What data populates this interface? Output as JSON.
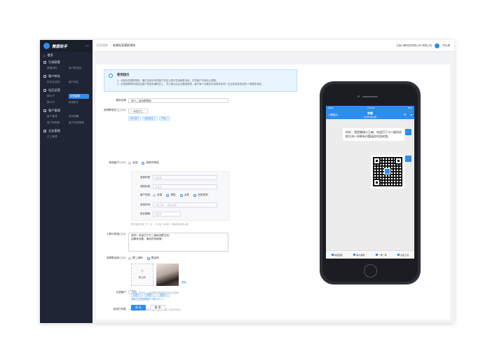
{
  "app": {
    "name": "微盟助手"
  },
  "sidebar": {
    "home": "首页",
    "groups": [
      {
        "title": "引流获客",
        "items": [
          "渠道活码",
          "客户群活码"
        ]
      },
      {
        "title": "客户转化",
        "items": [
          "好友欢迎语",
          "客户朋友"
        ]
      },
      {
        "title": "社区运营",
        "items": [
          "群SOP",
          "标签建群",
          "群SOP",
          "群发助手"
        ],
        "active_index": 1
      },
      {
        "title": "客户管理",
        "items": [
          "客户管理",
          "流失提醒",
          "客户群管理",
          "客户标签管理"
        ]
      },
      {
        "title": "企业管理",
        "items": [
          "员工管理"
        ]
      }
    ]
  },
  "topbar": {
    "crumb_parent": "标签建群",
    "crumb_current": "新建标签建群规则",
    "company": "艾迪小秦科技有限公司 有限公司",
    "user": "李大婶"
  },
  "tip": {
    "title": "使用指引",
    "lines": [
      "1、添加标签建群规则，通过对部分标签客户发送入群引导话和群活码，引导客户扫码加入群聊。",
      "2、标签建群规则发送至客户群发前通知员工，员工确认后企业微信群发，客户每个月最多可接收来自同一企业的消息发送的 4 条群发消息。"
    ]
  },
  "form": {
    "rule_name_label": "规则名称",
    "rule_name_value": "双十二活动群规则",
    "staff_label": "选择群发员工",
    "optional": "(选填)",
    "add_staff": "+ 添加员工",
    "staff_tags": [
      "李小明 ×",
      "张伟民生 ×",
      "严旭 ×"
    ],
    "filter_label": "筛选客户",
    "filter_options": [
      "全部",
      "按条件筛选"
    ],
    "filter_fields": [
      {
        "label": "选择标签:",
        "placeholder": "请选择"
      },
      {
        "label": "排除标签:",
        "placeholder": "请选择"
      },
      {
        "label": "客户性别:",
        "placeholder": ""
      },
      {
        "label": "添加时间:",
        "placeholder": "开始日期  →  结束日期"
      },
      {
        "label": "所在群聊:",
        "placeholder": "请选择"
      }
    ],
    "gender_options": [
      "全部",
      "男性",
      "女性",
      "未知性别"
    ],
    "filter_note": "预计发送人数 【*一人】   【人员】 时间时，查看筛选发送人数",
    "guide_label": "入群引导语",
    "guide_text": "您好！欢迎扫下方二维码进群交流~\n如果有问题，请及时咨询哦！",
    "code_label": "选择群活码",
    "code_options": [
      "群二维码",
      "群活码"
    ],
    "new_code": "新活码",
    "change_code": "更换",
    "filter_customer_label": "过滤客户",
    "filter_customer_hint": "开启后，已在群聊中的客户不会收到推荐",
    "filter_customer_sub": "查看已过滤的群客户人数  共 0 人",
    "auto_tag_label": "自动打标签",
    "auto_tag_add": "+ 添加标签",
    "auto_tag_hint": "以添加、客户通过扫码进入后自动添加",
    "auto_tags": [
      "标签1 ×",
      "标签2 ×",
      "标签3 ×"
    ],
    "save": "保 存",
    "cancel": "取 消"
  },
  "preview": {
    "status_left": "Sketch",
    "status_time": "下午2:38",
    "status_right": "100%",
    "back": "< 微盟(0)",
    "chat_name": "李静",
    "chat_sub": "北大附小家长群",
    "message": "你好，我是傲瑞小王麻，欢迎扫下方二维码进群交流～如果有问题请及时咨询我。",
    "bottom_items": [
      "快捷回复",
      "客户画像",
      "一客一码",
      "设置工具"
    ]
  }
}
